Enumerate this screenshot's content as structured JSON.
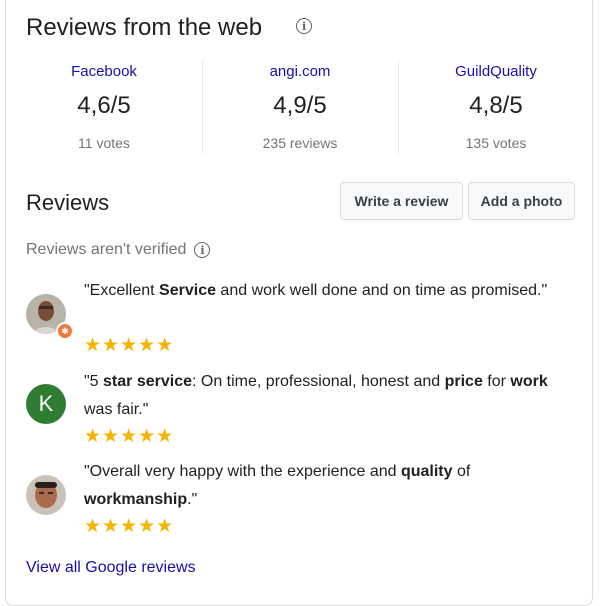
{
  "web_reviews": {
    "title": "Reviews from the web",
    "sources": [
      {
        "name": "Facebook",
        "score": "4,6/5",
        "count": "11 votes"
      },
      {
        "name": "angi.com",
        "score": "4,9/5",
        "count": "235 reviews"
      },
      {
        "name": "GuildQuality",
        "score": "4,8/5",
        "count": "135 votes"
      }
    ]
  },
  "reviews": {
    "title": "Reviews",
    "write_label": "Write a review",
    "photo_label": "Add a photo",
    "not_verified": "Reviews aren't verified",
    "items": [
      {
        "avatar_letter": "",
        "rating": 5,
        "parts": [
          {
            "t": "\"Excellent "
          },
          {
            "t": "Service",
            "b": true
          },
          {
            "t": " and work well done and on time as promised.\""
          }
        ]
      },
      {
        "avatar_letter": "K",
        "rating": 5,
        "parts": [
          {
            "t": "\"5 "
          },
          {
            "t": "star service",
            "b": true
          },
          {
            "t": ": On time, professional, honest and "
          },
          {
            "t": "price",
            "b": true
          },
          {
            "t": " for "
          },
          {
            "t": "work",
            "b": true
          },
          {
            "t": " was fair.\""
          }
        ]
      },
      {
        "avatar_letter": "",
        "rating": 5,
        "parts": [
          {
            "t": "\"Overall very happy with the experience and "
          },
          {
            "t": "quality",
            "b": true
          },
          {
            "t": " of "
          },
          {
            "t": "workmanship",
            "b": true
          },
          {
            "t": ".\""
          }
        ]
      }
    ],
    "view_all": "View all Google reviews"
  },
  "colors": {
    "link": "#1a0dab",
    "star": "#f4b400",
    "avatar_k": "#2e7d32",
    "badge": "#ef7b3b"
  }
}
